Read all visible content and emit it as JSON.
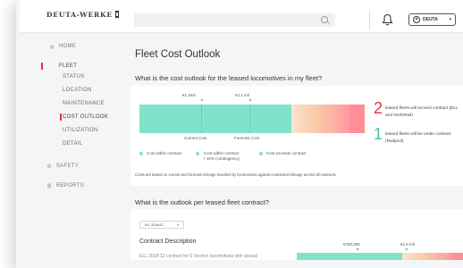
{
  "header": {
    "brand": "DEUTA-WERKE",
    "user_label": "DEUTA",
    "user_caret": "▾"
  },
  "sidebar": {
    "items": [
      {
        "label": "HOME",
        "icon": "home-icon"
      },
      {
        "label": "FLEET"
      },
      {
        "label": "STATUS"
      },
      {
        "label": "LOCATION"
      },
      {
        "label": "MAINTENANCE"
      },
      {
        "label": "COST OUTLOOK"
      },
      {
        "label": "UTILIZATION"
      },
      {
        "label": "DETAIL"
      },
      {
        "label": "SAFETY",
        "icon": "shield-icon"
      },
      {
        "label": "REPORTS",
        "icon": "document-icon"
      }
    ]
  },
  "page": {
    "title": "Fleet Cost Outlook",
    "q1": "What is the cost outlook for the leased locomotives in my fleet?",
    "q2": "What is the outlook per leased fleet contract?"
  },
  "chart_data": {
    "type": "bar",
    "top_labels": [
      "€1.3mil",
      "€2.1 mil"
    ],
    "bottom_labels": [
      "Current Cost",
      "Forecast Cost"
    ],
    "current_cost_mil": 1.3,
    "forecast_cost_mil": 2.1,
    "legend": [
      {
        "label": "Cost within contract",
        "color": "#7fe3c9"
      },
      {
        "label": "Cost within contract\n+ 10% (contingency)",
        "color": "#f9c9a6"
      },
      {
        "label": "Cost exceeds contract",
        "color": "#ff8f97"
      }
    ],
    "note": "Costs are based on current and forecast mileage travelled by locomotives against contracted mileage across all contracts.",
    "colors": {
      "within": "#7fe3c9",
      "contingency": "#f9c9a6",
      "exceeds": "#ff8f97",
      "marker": "#7ecfc6"
    }
  },
  "stats": [
    {
      "number": "2",
      "color": "#e8323c",
      "text": "leased fleets will exceed contract (ELL and NorthRail)"
    },
    {
      "number": "1",
      "color": "#3fc7a9",
      "text": "leased fleets will be under contract (Railpool)"
    }
  ],
  "contract": {
    "dropdown_value": "ELL 2018 A2",
    "dropdown_caret": "▾",
    "heading": "Contract Description",
    "desc_text": "ELL 2018-12 contract for 5 Vectron locomotives with annual",
    "top_labels": [
      "€750,000",
      "€1.6 mil"
    ]
  }
}
